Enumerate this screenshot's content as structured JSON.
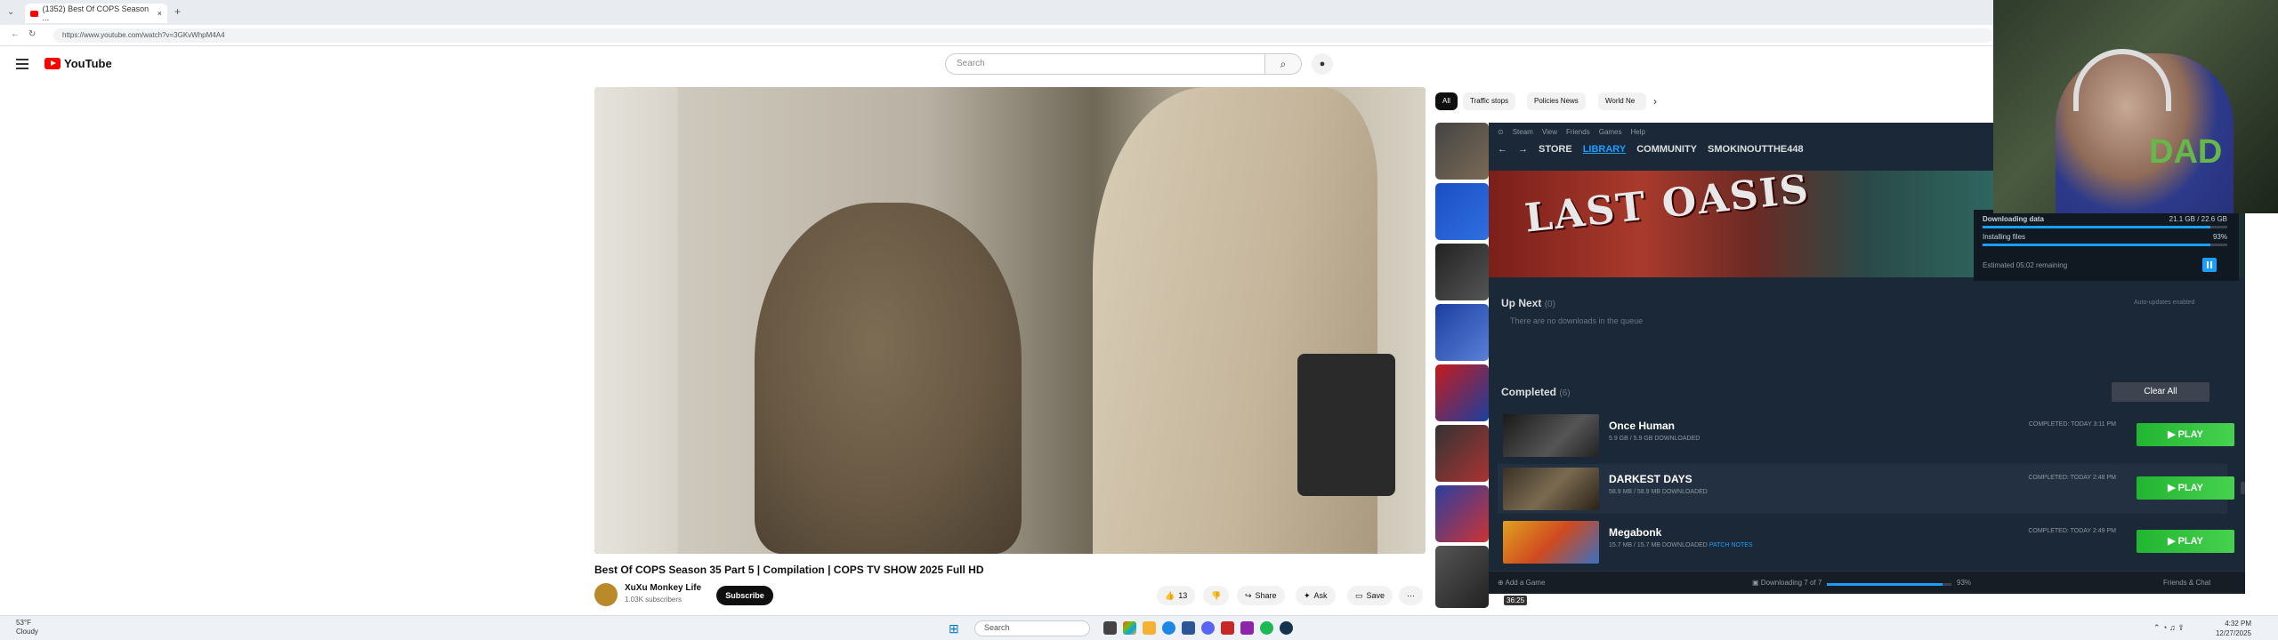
{
  "browser": {
    "tab_title": "(1352) Best Of COPS Season ...",
    "new_tab": "+",
    "url": "https://www.youtube.com/watch?v=3GKvWhpM4A4"
  },
  "youtube": {
    "logo_text": "YouTube",
    "search_placeholder": "Search",
    "chips": [
      "All",
      "Traffic stops",
      "Policies News",
      "World Ne"
    ],
    "video": {
      "title": "Best Of COPS Season 35 Part 5 | Compilation | COPS TV SHOW 2025 Full HD",
      "channel": "XuXu Monkey Life",
      "subscribers": "1.03K subscribers",
      "subscribe": "Subscribe",
      "likes": "13",
      "share": "Share",
      "ask": "Ask",
      "save": "Save"
    },
    "timestamp": "36:25"
  },
  "steam": {
    "menu": [
      "Steam",
      "View",
      "Friends",
      "Games",
      "Help"
    ],
    "nav": [
      "STORE",
      "LIBRARY",
      "COMMUNITY",
      "SMOKINOUTTHE448"
    ],
    "hero_title": "LAST OASIS",
    "download": {
      "label": "Downloading data",
      "size": "21.1 GB / 22.6 GB",
      "installing": "Installing files",
      "install_pct": "93%",
      "download_progress": 0.93,
      "install_progress": 0.93,
      "remaining": "Estimated 05:02 remaining"
    },
    "up_next": {
      "title": "Up Next",
      "count": "(0)",
      "empty": "There are no downloads in the queue",
      "auto": "Auto-updates enabled"
    },
    "completed": {
      "title": "Completed",
      "count": "(6)",
      "clear": "Clear All"
    },
    "games": [
      {
        "name": "Once Human",
        "size": "5.9 GB / 5.9 GB DOWNLOADED",
        "notes": "",
        "completed": "COMPLETED: TODAY 3:11 PM",
        "play": "PLAY"
      },
      {
        "name": "DARKEST DAYS",
        "size": "58.9 MB / 58.9 MB DOWNLOADED",
        "notes": "",
        "completed": "COMPLETED: TODAY 2:48 PM",
        "play": "PLAY"
      },
      {
        "name": "Megabonk",
        "size": "15.7 MB / 15.7 MB DOWNLOADED",
        "notes": "PATCH NOTES",
        "completed": "COMPLETED: TODAY 2:49 PM",
        "play": "PLAY"
      }
    ],
    "footer": {
      "add_game": "Add a Game",
      "downloading": "Downloading 7 of 7",
      "pct": "93%",
      "progress": 0.93,
      "friends": "Friends & Chat"
    }
  },
  "webcam": {
    "hood_text": "DAD"
  },
  "taskbar": {
    "weather_temp": "53°F",
    "weather_desc": "Cloudy",
    "search": "Search",
    "time": "4:32 PM",
    "date": "12/27/2025"
  },
  "colors": {
    "steam_bg": "#1b2838",
    "steam_accent": "#1a9fff",
    "play_green": "#21b531",
    "yt_red": "#ff0000"
  }
}
